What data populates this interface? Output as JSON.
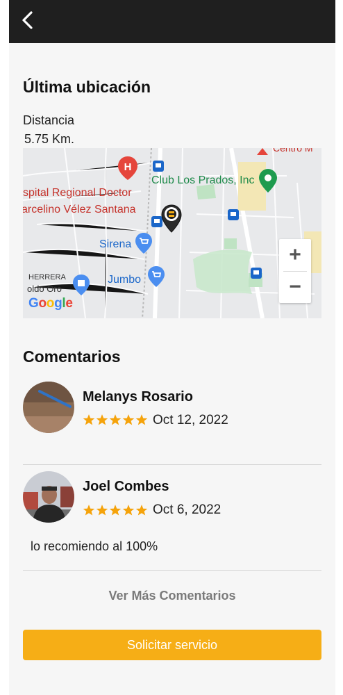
{
  "header": {
    "back_icon": "chevron-left-icon"
  },
  "location": {
    "title": "Última ubicación",
    "distance_label": "Distancia",
    "distance_value": "5.75 Km."
  },
  "map": {
    "labels": {
      "hospital_line1": "spital Regional Doctor",
      "hospital_line2": "arcelino Vélez Santana",
      "club": "Club Los Prados, Inc",
      "sirena": "Sirena",
      "jumbo": "Jumbo",
      "herrera": "HERRERA",
      "oro": "oldo Oro",
      "centro": "Centro M",
      "google": "Google"
    },
    "zoom_in": "+",
    "zoom_out": "−"
  },
  "comments": {
    "title": "Comentarios",
    "reviews": [
      {
        "name": "Melanys Rosario",
        "rating": 5,
        "date": "Oct 12, 2022",
        "text": ""
      },
      {
        "name": "Joel Combes",
        "rating": 5,
        "date": "Oct 6, 2022",
        "text": "lo recomiendo al 100%"
      }
    ],
    "more_label": "Ver Más Comentarios"
  },
  "cta": {
    "label": "Solicitar servicio"
  },
  "colors": {
    "accent": "#f6ae16",
    "star": "#f5a30b",
    "topbar": "#1f1f1f"
  }
}
